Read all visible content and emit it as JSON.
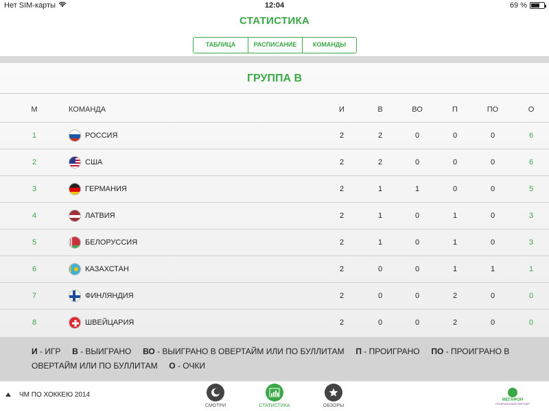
{
  "status": {
    "carrier": "Нет SIM-карты",
    "time": "12:04",
    "battery_text": "69 %",
    "battery_level": 0.69
  },
  "header": {
    "title": "СТАТИСТИКА"
  },
  "tabs": [
    {
      "label": "ТАБЛИЦА",
      "active": true
    },
    {
      "label": "РАСПИСАНИЕ",
      "active": false
    },
    {
      "label": "КОМАНДЫ",
      "active": false
    }
  ],
  "group": {
    "title": "ГРУППА B"
  },
  "table": {
    "headers": {
      "m": "М",
      "team": "КОМАНДА",
      "i": "И",
      "v": "В",
      "vo": "ВО",
      "p": "П",
      "po": "ПО",
      "o": "О"
    },
    "rows": [
      {
        "m": "1",
        "team": "РОССИЯ",
        "flag": "russia",
        "i": "2",
        "v": "2",
        "vo": "0",
        "p": "0",
        "po": "0",
        "o": "6"
      },
      {
        "m": "2",
        "team": "США",
        "flag": "usa",
        "i": "2",
        "v": "2",
        "vo": "0",
        "p": "0",
        "po": "0",
        "o": "6"
      },
      {
        "m": "3",
        "team": "ГЕРМАНИЯ",
        "flag": "germany",
        "i": "2",
        "v": "1",
        "vo": "1",
        "p": "0",
        "po": "0",
        "o": "5"
      },
      {
        "m": "4",
        "team": "ЛАТВИЯ",
        "flag": "latvia",
        "i": "2",
        "v": "1",
        "vo": "0",
        "p": "1",
        "po": "0",
        "o": "3"
      },
      {
        "m": "5",
        "team": "БЕЛОРУССИЯ",
        "flag": "belarus",
        "i": "2",
        "v": "1",
        "vo": "0",
        "p": "1",
        "po": "0",
        "o": "3"
      },
      {
        "m": "6",
        "team": "КАЗАХСТАН",
        "flag": "kazakhstan",
        "i": "2",
        "v": "0",
        "vo": "0",
        "p": "1",
        "po": "1",
        "o": "1"
      },
      {
        "m": "7",
        "team": "ФИНЛЯНДИЯ",
        "flag": "finland",
        "i": "2",
        "v": "0",
        "vo": "0",
        "p": "2",
        "po": "0",
        "o": "0"
      },
      {
        "m": "8",
        "team": "ШВЕЙЦАРИЯ",
        "flag": "switzerland",
        "i": "2",
        "v": "0",
        "vo": "0",
        "p": "2",
        "po": "0",
        "o": "0"
      }
    ]
  },
  "legend": {
    "i_key": "И",
    "i_desc": " - ИГР",
    "v_key": "В",
    "v_desc": " - ВЫИГРАНО",
    "vo_key": "ВО",
    "vo_desc": " - ВЫИГРАНО В ОВЕРТАЙМ ИЛИ ПО БУЛЛИТАМ",
    "p_key": "П",
    "p_desc": " - ПРОИГРАНО",
    "po_key": "ПО",
    "po_desc": " - ПРОИГРАНО В ОВЕРТАЙМ ИЛИ ПО БУЛЛИТАМ",
    "o_key": "О",
    "o_desc": " - ОЧКИ"
  },
  "tabbar": {
    "championship": "ЧМ ПО ХОККЕЮ 2014",
    "items": [
      {
        "label": "СМОТРИ",
        "icon": "watch-icon",
        "active": false
      },
      {
        "label": "СТАТИСТИКА",
        "icon": "stats-icon",
        "active": true
      },
      {
        "label": "ОБЗОРЫ",
        "icon": "star-icon",
        "active": false
      }
    ],
    "logo_text": "МЕГАФОН",
    "logo_sub": "ГЕНЕРАЛЬНЫЙ ПАРТНЕР"
  },
  "colors": {
    "accent": "#3aa846",
    "legend_bg": "#d3d3d3",
    "tab_icon": "#444444"
  }
}
